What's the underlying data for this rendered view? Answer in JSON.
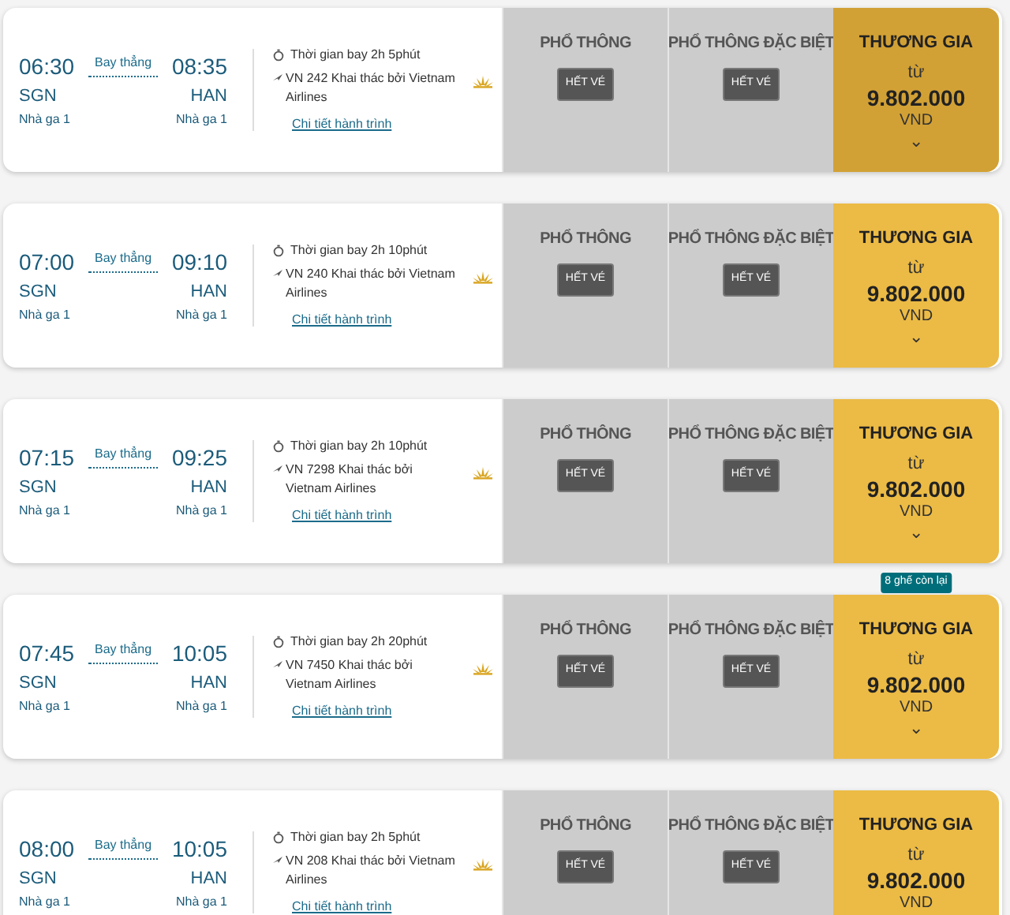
{
  "flights": [
    {
      "depart_time": "06:30",
      "arrive_time": "08:35",
      "route_type": "Bay thẳng",
      "from": "SGN",
      "to": "HAN",
      "from_terminal": "Nhà ga 1",
      "to_terminal": "Nhà ga 1",
      "duration": "Thời gian bay 2h 5phút",
      "flight_lines": [
        "VN 242 Khai thác bởi Vietnam",
        "Airlines"
      ],
      "details_link": "Chi tiết hành trình",
      "highlighted": true,
      "fares": [
        {
          "cabin": "PHỔ THÔNG",
          "kind": "soldout",
          "status": "HẾT VÉ"
        },
        {
          "cabin": "PHỔ THÔNG ĐẶC BIỆT",
          "kind": "soldout",
          "status": "HẾT VÉ"
        },
        {
          "cabin": "THƯƠNG GIA",
          "kind": "price",
          "from_label": "từ",
          "price": "9.802.000",
          "currency": "VND",
          "expand": "⌄"
        }
      ]
    },
    {
      "depart_time": "07:00",
      "arrive_time": "09:10",
      "route_type": "Bay thẳng",
      "from": "SGN",
      "to": "HAN",
      "from_terminal": "Nhà ga 1",
      "to_terminal": "Nhà ga 1",
      "duration": "Thời gian bay 2h 10phút",
      "flight_lines": [
        "VN 240 Khai thác bởi Vietnam",
        "Airlines"
      ],
      "details_link": "Chi tiết hành trình",
      "highlighted": false,
      "fares": [
        {
          "cabin": "PHỔ THÔNG",
          "kind": "soldout",
          "status": "HẾT VÉ"
        },
        {
          "cabin": "PHỔ THÔNG ĐẶC BIỆT",
          "kind": "soldout",
          "status": "HẾT VÉ"
        },
        {
          "cabin": "THƯƠNG GIA",
          "kind": "price",
          "from_label": "từ",
          "price": "9.802.000",
          "currency": "VND",
          "expand": "⌄"
        }
      ]
    },
    {
      "depart_time": "07:15",
      "arrive_time": "09:25",
      "route_type": "Bay thẳng",
      "from": "SGN",
      "to": "HAN",
      "from_terminal": "Nhà ga 1",
      "to_terminal": "Nhà ga 1",
      "duration": "Thời gian bay 2h 10phút",
      "flight_lines": [
        "VN 7298 Khai thác bởi",
        "Vietnam Airlines"
      ],
      "details_link": "Chi tiết hành trình",
      "highlighted": false,
      "fares": [
        {
          "cabin": "PHỔ THÔNG",
          "kind": "soldout",
          "status": "HẾT VÉ"
        },
        {
          "cabin": "PHỔ THÔNG ĐẶC BIỆT",
          "kind": "soldout",
          "status": "HẾT VÉ"
        },
        {
          "cabin": "THƯƠNG GIA",
          "kind": "price",
          "from_label": "từ",
          "price": "9.802.000",
          "currency": "VND",
          "expand": "⌄"
        }
      ]
    },
    {
      "depart_time": "07:45",
      "arrive_time": "10:05",
      "route_type": "Bay thẳng",
      "from": "SGN",
      "to": "HAN",
      "from_terminal": "Nhà ga 1",
      "to_terminal": "Nhà ga 1",
      "duration": "Thời gian bay 2h 20phút",
      "flight_lines": [
        "VN 7450 Khai thác bởi",
        "Vietnam Airlines"
      ],
      "details_link": "Chi tiết hành trình",
      "highlighted": false,
      "fares": [
        {
          "cabin": "PHỔ THÔNG",
          "kind": "soldout",
          "status": "HẾT VÉ"
        },
        {
          "cabin": "PHỔ THÔNG ĐẶC BIỆT",
          "kind": "soldout",
          "status": "HẾT VÉ"
        },
        {
          "cabin": "THƯƠNG GIA",
          "kind": "price",
          "seats_left": "8 ghế còn lại",
          "from_label": "từ",
          "price": "9.802.000",
          "currency": "VND",
          "expand": "⌄"
        }
      ]
    },
    {
      "depart_time": "08:00",
      "arrive_time": "10:05",
      "route_type": "Bay thẳng",
      "from": "SGN",
      "to": "HAN",
      "from_terminal": "Nhà ga 1",
      "to_terminal": "Nhà ga 1",
      "duration": "Thời gian bay 2h 5phút",
      "flight_lines": [
        "VN 208 Khai thác bởi Vietnam",
        "Airlines"
      ],
      "details_link": "Chi tiết hành trình",
      "highlighted": false,
      "fares": [
        {
          "cabin": "PHỔ THÔNG",
          "kind": "soldout",
          "status": "HẾT VÉ"
        },
        {
          "cabin": "PHỔ THÔNG ĐẶC BIỆT",
          "kind": "soldout",
          "status": "HẾT VÉ"
        },
        {
          "cabin": "THƯƠNG GIA",
          "kind": "price",
          "from_label": "từ",
          "price": "9.802.000",
          "currency": "VND"
        }
      ]
    }
  ]
}
